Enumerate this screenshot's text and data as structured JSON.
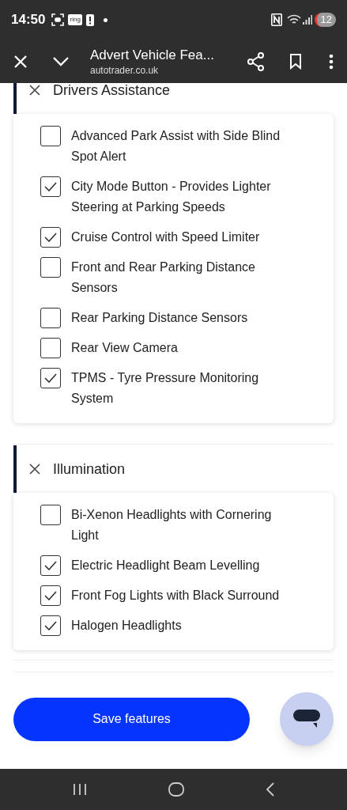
{
  "status_bar": {
    "time": "14:50",
    "app_badge": "ring",
    "battery": "12"
  },
  "browser_bar": {
    "title": "Advert Vehicle Fea...",
    "url": "autotrader.co.uk"
  },
  "sections": [
    {
      "title": "Drivers Assistance",
      "expanded": true,
      "items": [
        {
          "label": "Advanced Park Assist with Side Blind Spot Alert",
          "checked": false
        },
        {
          "label": "City Mode Button - Provides Lighter Steering at Parking Speeds",
          "checked": true
        },
        {
          "label": "Cruise Control with Speed Limiter",
          "checked": true
        },
        {
          "label": "Front and Rear Parking Distance Sensors",
          "checked": false
        },
        {
          "label": "Rear Parking Distance Sensors",
          "checked": false
        },
        {
          "label": "Rear View Camera",
          "checked": false
        },
        {
          "label": "TPMS - Tyre Pressure Monitoring System",
          "checked": true
        }
      ]
    },
    {
      "title": "Illumination",
      "expanded": true,
      "items": [
        {
          "label": "Bi-Xenon Headlights with Cornering Light",
          "checked": false
        },
        {
          "label": "Electric Headlight Beam Levelling",
          "checked": true
        },
        {
          "label": "Front Fog Lights with Black Surround",
          "checked": true
        },
        {
          "label": "Halogen Headlights",
          "checked": true
        }
      ]
    }
  ],
  "save_button": "Save features"
}
